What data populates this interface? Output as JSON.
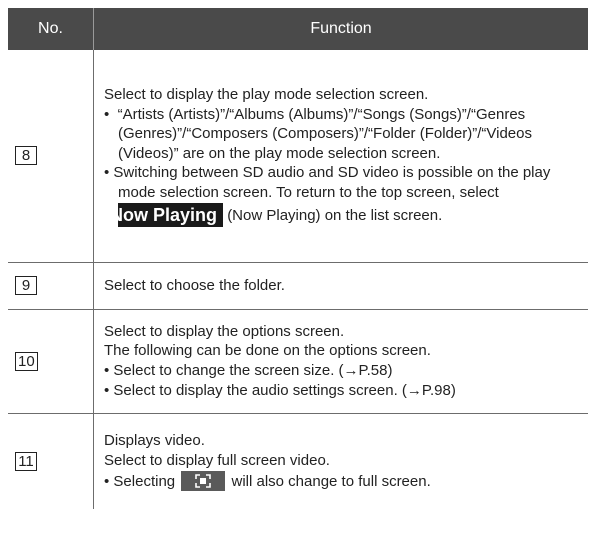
{
  "header": {
    "col_no": "No.",
    "col_function": "Function"
  },
  "rows": [
    {
      "num": "8",
      "intro": "Select to display the play mode selection screen.",
      "bullet1": "“Artists (Artists)”/“Albums (Albums)”/“Songs (Songs)”/“Genres (Genres)”/“Composers (Composers)”/“Folder (Folder)”/“Videos (Videos)” are on the play mode selection screen.",
      "bullet2_pre": "Switching between SD audio and SD video is possible on the play mode selection screen. To return to the top screen, select",
      "button_label": "Now Playing",
      "bullet2_post": "(Now Playing) on the list screen."
    },
    {
      "num": "9",
      "text": "Select to choose the folder."
    },
    {
      "num": "10",
      "line1": "Select to display the options screen.",
      "line2": "The following can be done on the options screen.",
      "bullet1": "Select to change the screen size. (→P.58)",
      "bullet2": "Select to display the audio settings screen. (→P.98)"
    },
    {
      "num": "11",
      "line1": "Displays video.",
      "line2": "Select to display full screen video.",
      "bullet_pre": "Selecting",
      "bullet_post": "will also change to full screen.",
      "icon": "fullscreen-icon"
    }
  ]
}
